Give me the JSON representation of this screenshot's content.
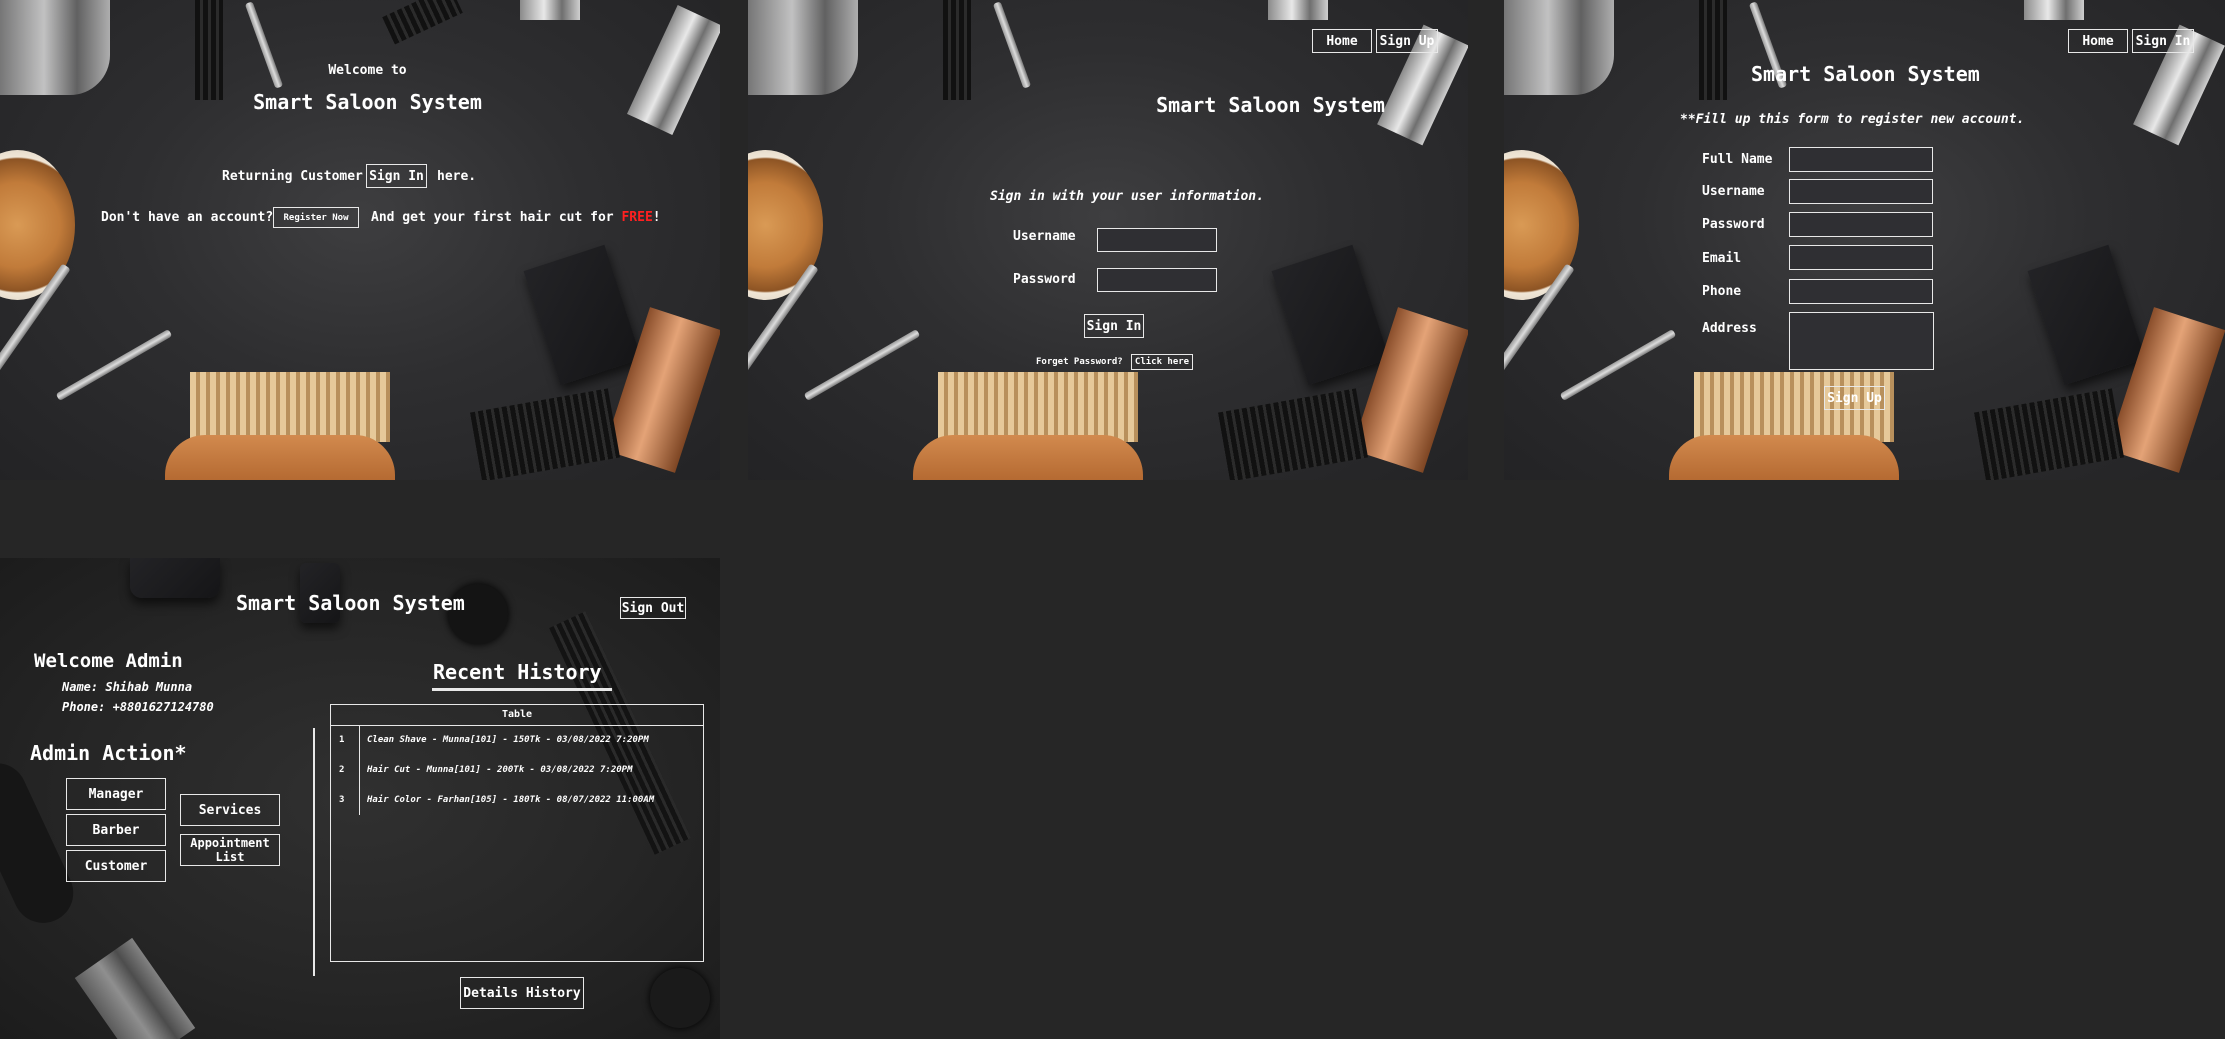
{
  "screen1": {
    "welcome": "Welcome to",
    "title": "Smart Saloon System",
    "returning_prefix": "Returning Customer",
    "signin_button": "Sign In",
    "returning_suffix": "here.",
    "no_account": "Don't have an account?",
    "register_button": "Register Now",
    "promo_prefix": "And get your first hair cut for",
    "promo_highlight": "FREE",
    "promo_suffix": "!"
  },
  "screen2": {
    "nav_home": "Home",
    "nav_signup": "Sign Up",
    "title": "Smart Saloon System",
    "subtitle": "Sign in with your user information.",
    "username_label": "Username",
    "password_label": "Password",
    "signin_button": "Sign In",
    "forgot_text": "Forget Password?",
    "click_here": "Click here"
  },
  "screen3": {
    "nav_home": "Home",
    "nav_signin": "Sign In",
    "title": "Smart Saloon System",
    "subtitle": "**Fill up this form to register new account.",
    "fields": {
      "fullname": "Full Name",
      "username": "Username",
      "password": "Password",
      "email": "Email",
      "phone": "Phone",
      "address": "Address"
    },
    "signup_button": "Sign Up"
  },
  "screen4": {
    "title": "Smart Saloon System",
    "signout_button": "Sign Out",
    "welcome": "Welcome Admin",
    "name_line": "Name: Shihab Munna",
    "phone_line": "Phone: +8801627124780",
    "actions_title": "Admin Action*",
    "actions": {
      "manager": "Manager",
      "barber": "Barber",
      "customer": "Customer",
      "services": "Services",
      "appointment_line1": "Appointment",
      "appointment_line2": "List"
    },
    "history_title": "Recent History",
    "table_caption": "Table",
    "rows": [
      {
        "num": "1",
        "text": "Clean Shave - Munna[101] - 150Tk - 03/08/2022 7:20PM"
      },
      {
        "num": "2",
        "text": "Hair Cut - Munna[101] - 200Tk - 03/08/2022 7:20PM"
      },
      {
        "num": "3",
        "text": "Hair Color - Farhan[105] - 180Tk - 08/07/2022 11:00AM"
      }
    ],
    "details_button": "Details History"
  },
  "colors": {
    "page_bg": "#262626",
    "accent_free": "#ff2020",
    "border": "#e8e8e8"
  }
}
